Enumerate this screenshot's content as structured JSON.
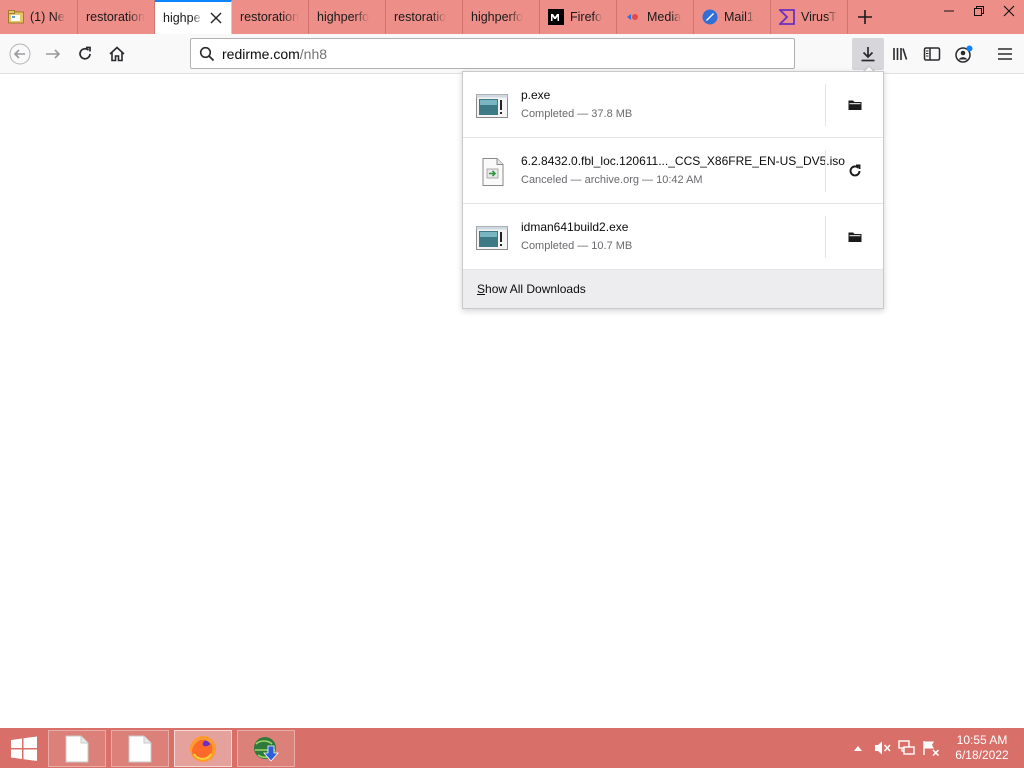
{
  "tabs": [
    {
      "label": "(1) Ne",
      "icon": "folder-news-icon",
      "active": false
    },
    {
      "label": "restoration",
      "icon": "",
      "active": false
    },
    {
      "label": "highpe",
      "icon": "",
      "active": true
    },
    {
      "label": "restoration",
      "icon": "",
      "active": false
    },
    {
      "label": "highperfo",
      "icon": "",
      "active": false
    },
    {
      "label": "restoratio",
      "icon": "",
      "active": false
    },
    {
      "label": "highperfo",
      "icon": "",
      "active": false
    },
    {
      "label": "Firefo",
      "icon": "m-logo-icon",
      "active": false
    },
    {
      "label": "Media",
      "icon": "media-icon",
      "active": false
    },
    {
      "label": "Mail1",
      "icon": "mail-icon",
      "active": false
    },
    {
      "label": "VirusT",
      "icon": "virustotal-icon",
      "active": false
    }
  ],
  "urlbar": {
    "host": "redirme.com",
    "path": "/nh8"
  },
  "downloads": {
    "items": [
      {
        "name": "p.exe",
        "status": "Completed — 37.8 MB",
        "icon": "exe-file-icon",
        "action_icon": "open-folder-icon"
      },
      {
        "name": "6.2.8432.0.fbl_loc.120611..._CCS_X86FRE_EN-US_DV5.iso",
        "status": "Canceled — archive.org — 10:42 AM",
        "icon": "iso-file-icon",
        "action_icon": "retry-icon"
      },
      {
        "name": "idman641build2.exe",
        "status": "Completed — 10.7 MB",
        "icon": "exe-file-icon",
        "action_icon": "open-folder-icon"
      }
    ],
    "footer_accesskey": "S",
    "footer_rest": "how All Downloads"
  },
  "taskbar": {
    "time": "10:55 AM",
    "date": "6/18/2022"
  },
  "colors": {
    "tabstrip": "#ed8e89",
    "taskbar": "#d86f68",
    "active_tab_accent": "#0a84ff",
    "toolbar": "#f9f9fa"
  }
}
